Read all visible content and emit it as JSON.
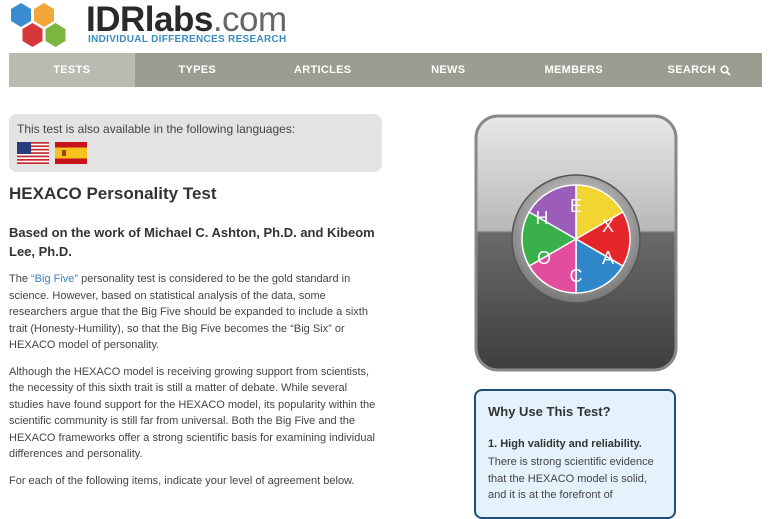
{
  "logo": {
    "brand_bold": "IDRlabs",
    "brand_domain": ".com",
    "tagline": "INDIVIDUAL DIFFERENCES RESEARCH"
  },
  "nav": {
    "items": [
      "TESTS",
      "TYPES",
      "ARTICLES",
      "NEWS",
      "MEMBERS",
      "SEARCH"
    ],
    "active": "TESTS"
  },
  "languages": {
    "text": "This test is also available in the following languages:",
    "flags": [
      "us-flag-icon",
      "spain-flag-icon"
    ]
  },
  "article": {
    "title": "HEXACO Personality Test",
    "subtitle": "Based on the work of Michael C. Ashton, Ph.D. and Kibeom Lee, Ph.D.",
    "p1_link": "“Big Five”",
    "p1_rest": " personality test is considered to be the gold standard in science. However, based on statistical analysis of the data, some researchers argue that the Big Five should be expanded to include a sixth trait (Honesty-Humility), so that the Big Five becomes the “Big Six” or HEXACO model of personality.",
    "p1_prefix": "The ",
    "p2": "Although the HEXACO model is receiving growing support from scientists, the necessity of this sixth trait is still a matter of debate. While several studies have found support for the HEXACO model, its popularity within the scientific community is still far from universal. Both the Big Five and the HEXACO frameworks offer a strong scientific basis for examining individual differences and personality.",
    "p3": "For each of the following items, indicate your level of agreement below."
  },
  "icon_letters": [
    "H",
    "E",
    "X",
    "A",
    "C",
    "O"
  ],
  "why": {
    "title": "Why Use This Test?",
    "item1_title": "1. High validity and reliability.",
    "item1_text": "There is strong scientific evidence that the HEXACO model is solid, and it is at the forefront of"
  },
  "colors": {
    "nav_bg": "#9a9d8f",
    "nav_active": "#b9bbb1",
    "link": "#3b7ec0",
    "why_border": "#1e4e78",
    "why_bg": "#e3f2fb"
  }
}
